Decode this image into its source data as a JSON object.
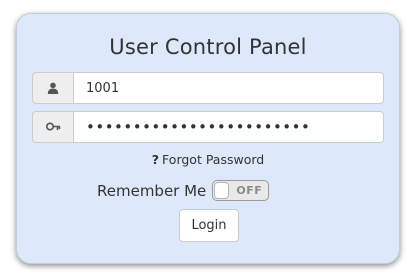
{
  "panel": {
    "title": "User Control Panel",
    "username": {
      "value": "1001",
      "icon": "user-icon"
    },
    "password": {
      "value": "••••••••••••••••••••••••",
      "icon": "key-icon"
    },
    "forgot": {
      "icon": "question-icon",
      "icon_glyph": "?",
      "label": "Forgot Password"
    },
    "remember": {
      "label": "Remember Me",
      "state": "OFF",
      "on": false
    },
    "login_label": "Login"
  }
}
